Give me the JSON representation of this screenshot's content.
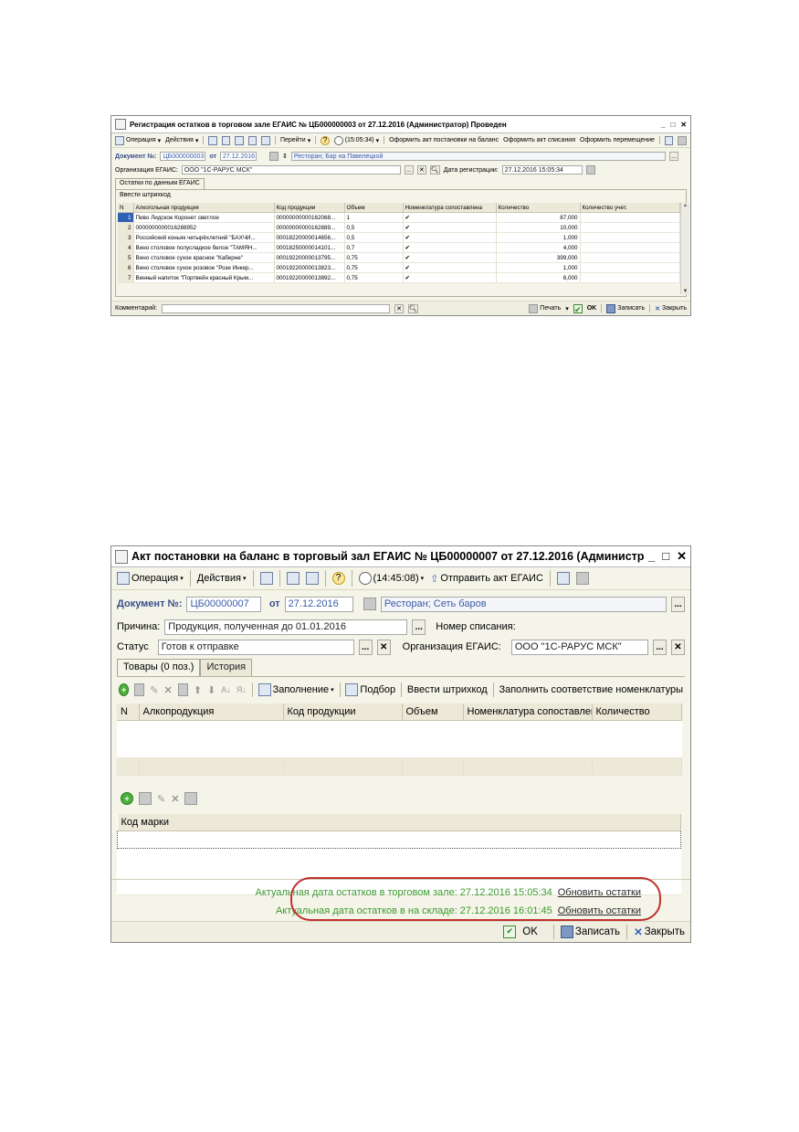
{
  "win1": {
    "title": "Регистрация остатков в торговом зале ЕГАИС № ЦБ000000003 от 27.12.2016 (Администратор) Проведен",
    "toolbar": {
      "operation": "Операция",
      "actions": "Действия",
      "goto": "Перейти",
      "time": "(15:05:34)",
      "act_balance": "Оформить акт постановки на баланс",
      "act_writeoff": "Оформить акт списания",
      "transfer": "Оформить перемещение"
    },
    "doc": {
      "label": "Документ №:",
      "number": "ЦБ000000003",
      "from_label": "от",
      "date": "27.12.2016",
      "place": "Ресторан; Бар на Павелецкой"
    },
    "org": {
      "label": "Организация ЕГАИС:",
      "value": "ООО \"1С-РАРУС МСК\"",
      "reg_label": "Дата регистрации:",
      "reg_value": "27.12.2016 15:05:34"
    },
    "tab": "Остатки по данным ЕГАИС",
    "barcode_btn": "Ввести штрихкод",
    "columns": [
      "N",
      "Алкогольная продукция",
      "Код продукции",
      "Объем",
      "Номенклатура сопоставлена",
      "Количество",
      "Количество учет."
    ],
    "rows": [
      {
        "n": "1",
        "name": "Пиво Лидское Коронет светлое",
        "code": "00000000000162068...",
        "vol": "1",
        "match": "✔",
        "qty": "87,000",
        "qty_acc": ""
      },
      {
        "n": "2",
        "name": "0000000000016288952",
        "code": "00000000000162889...",
        "vol": "0,5",
        "match": "✔",
        "qty": "10,000",
        "qty_acc": ""
      },
      {
        "n": "3",
        "name": "Российский коньяк четырёхлетний \"БАХЧИ...",
        "code": "00018220000014656...",
        "vol": "0,5",
        "match": "✔",
        "qty": "1,000",
        "qty_acc": ""
      },
      {
        "n": "4",
        "name": "Вино столовое полусладкое белое \"ТАМЯН...",
        "code": "00018250000014101...",
        "vol": "0,7",
        "match": "✔",
        "qty": "4,000",
        "qty_acc": ""
      },
      {
        "n": "5",
        "name": "Вино столовое сухое красное \"Каберне\"",
        "code": "00019220000013795...",
        "vol": "0,75",
        "match": "✔",
        "qty": "399,000",
        "qty_acc": ""
      },
      {
        "n": "6",
        "name": "Вино столовое сухое розовое \"Розе Инкер...",
        "code": "00019220000013823...",
        "vol": "0,75",
        "match": "✔",
        "qty": "1,000",
        "qty_acc": ""
      },
      {
        "n": "7",
        "name": "Винный напиток \"Портвейн красный Крым...",
        "code": "00019220000013892...",
        "vol": "0,75",
        "match": "✔",
        "qty": "6,000",
        "qty_acc": ""
      }
    ],
    "footer": {
      "comment_label": "Комментарий:",
      "print": "Печать",
      "ok": "OK",
      "save": "Записать",
      "close": "Закрыть"
    }
  },
  "win2": {
    "title": "Акт постановки на баланс в торговый зал ЕГАИС № ЦБ00000007 от 27.12.2016 (Администратор) Записан",
    "toolbar": {
      "operation": "Операция",
      "actions": "Действия",
      "time": "(14:45:08)",
      "send": "Отправить акт ЕГАИС"
    },
    "doc": {
      "label": "Документ №:",
      "number": "ЦБ00000007",
      "from_label": "от",
      "date": "27.12.2016",
      "place": "Ресторан; Сеть баров"
    },
    "reason": {
      "label": "Причина:",
      "value": "Продукция, полученная до 01.01.2016",
      "writeoff_label": "Номер списания:"
    },
    "status": {
      "label": "Статус",
      "value": "Готов к отправке",
      "org_label": "Организация ЕГАИС:",
      "org_value": "ООО \"1С-РАРУС МСК\""
    },
    "tabs": [
      "Товары (0 поз.)",
      "История"
    ],
    "goods_toolbar": {
      "fill": "Заполнение",
      "pick": "Подбор",
      "barcode": "Ввести штрихкод",
      "match": "Заполнить соответствие номенклатуры"
    },
    "columns": [
      "N",
      "Алкопродукция",
      "Код продукции",
      "Объем",
      "Номенклатура сопоставлена",
      "Количество"
    ],
    "marks_header": "Код марки",
    "status_lines": [
      {
        "text": "Актуальная дата остатков в торговом зале: 27.12.2016 15:05:34",
        "link": "Обновить остатки"
      },
      {
        "text": "Актуальная дата остатков в на складе: 27.12.2016 16:01:45",
        "link": "Обновить остатки"
      }
    ],
    "footer": {
      "ok": "OK",
      "save": "Записать",
      "close": "Закрыть"
    }
  }
}
